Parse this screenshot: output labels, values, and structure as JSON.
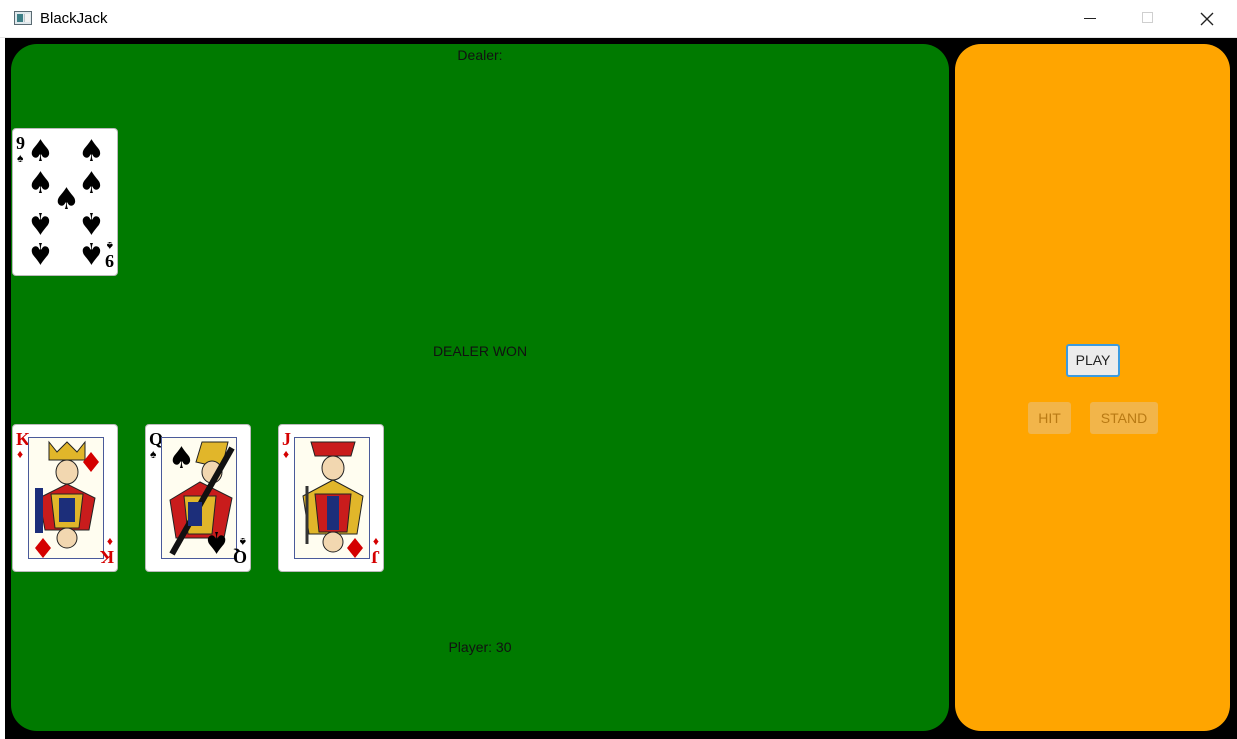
{
  "window": {
    "title": "BlackJack"
  },
  "table": {
    "dealer_label": "Dealer:",
    "result_text": "DEALER WON",
    "player_label": "Player: 30",
    "dealer_cards": [
      {
        "rank": "9",
        "suit": "spades",
        "suit_symbol": "♠",
        "color": "#000000"
      }
    ],
    "player_cards": [
      {
        "rank": "K",
        "suit": "diamonds",
        "suit_symbol": "♦",
        "color": "#d40000"
      },
      {
        "rank": "Q",
        "suit": "spades",
        "suit_symbol": "♠",
        "color": "#000000"
      },
      {
        "rank": "J",
        "suit": "diamonds",
        "suit_symbol": "♦",
        "color": "#d40000"
      }
    ],
    "felt_color": "#007a00"
  },
  "controls": {
    "play_label": "PLAY",
    "hit_label": "HIT",
    "stand_label": "STAND",
    "hit_enabled": false,
    "stand_enabled": false,
    "panel_color": "#ffa500"
  },
  "icons": {
    "app": "app-window-icon",
    "minimize": "minimize-icon",
    "maximize": "maximize-icon",
    "close": "close-icon"
  }
}
